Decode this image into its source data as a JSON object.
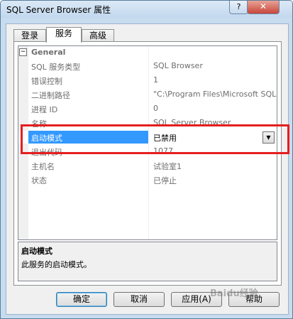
{
  "window": {
    "title": "SQL Server Browser 属性",
    "help_label": "?",
    "close_label": "✕"
  },
  "tabs": [
    {
      "label": "登录",
      "active": false
    },
    {
      "label": "服务",
      "active": true
    },
    {
      "label": "高级",
      "active": false
    }
  ],
  "property_grid": {
    "category": "General",
    "category_toggle": "−",
    "rows": [
      {
        "name": "SQL 服务类型",
        "value": "SQL Browser"
      },
      {
        "name": "错误控制",
        "value": "1"
      },
      {
        "name": "二进制路径",
        "value": "\"C:\\Program Files\\Microsoft SQL"
      },
      {
        "name": "进程 ID",
        "value": "0"
      },
      {
        "name": "名称",
        "value": "SQL Server Browser"
      },
      {
        "name": "启动模式",
        "value": "已禁用",
        "selected": true
      },
      {
        "name": "退出代码",
        "value": "1077"
      },
      {
        "name": "主机名",
        "value": "试验室1"
      },
      {
        "name": "状态",
        "value": "已停止"
      }
    ],
    "dropdown_icon": "▼"
  },
  "description": {
    "title": "启动模式",
    "text": "此服务的启动模式。"
  },
  "buttons": {
    "ok": "确定",
    "cancel": "取消",
    "apply": "应用(A)",
    "help": "帮助"
  },
  "highlight_color": "#e51e1e",
  "watermark": "Baidu经验"
}
